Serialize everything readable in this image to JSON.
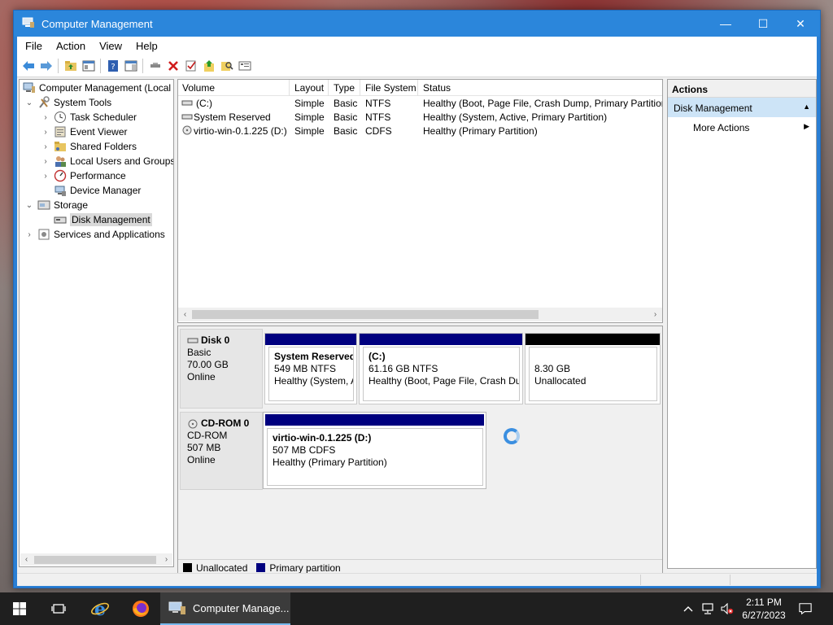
{
  "window": {
    "title": "Computer Management",
    "minimize_glyph": "—",
    "maximize_glyph": "☐",
    "close_glyph": "✕"
  },
  "menu": [
    "File",
    "Action",
    "View",
    "Help"
  ],
  "toolbar_icons": [
    "back-icon",
    "forward-icon",
    "up-folder-icon",
    "show-hide-tree-icon",
    "help-icon",
    "properties-view-icon",
    "connect-icon",
    "delete-icon",
    "check-icon",
    "import-icon",
    "search-icon",
    "disk-list-icon"
  ],
  "tree": {
    "root": "Computer Management (Local",
    "system_tools": "System Tools",
    "task_scheduler": "Task Scheduler",
    "event_viewer": "Event Viewer",
    "shared_folders": "Shared Folders",
    "local_users": "Local Users and Groups",
    "performance": "Performance",
    "device_manager": "Device Manager",
    "storage": "Storage",
    "disk_management": "Disk Management",
    "services": "Services and Applications"
  },
  "volumes": {
    "headers": {
      "volume": "Volume",
      "layout": "Layout",
      "type": "Type",
      "fs": "File System",
      "status": "Status"
    },
    "rows": [
      {
        "volume": "(C:)",
        "layout": "Simple",
        "type": "Basic",
        "fs": "NTFS",
        "status": "Healthy (Boot, Page File, Crash Dump, Primary Partition"
      },
      {
        "volume": "System Reserved",
        "layout": "Simple",
        "type": "Basic",
        "fs": "NTFS",
        "status": "Healthy (System, Active, Primary Partition)"
      },
      {
        "volume": "virtio-win-0.1.225 (D:)",
        "layout": "Simple",
        "type": "Basic",
        "fs": "CDFS",
        "status": "Healthy (Primary Partition)"
      }
    ]
  },
  "disks": {
    "disk0": {
      "name": "Disk 0",
      "type": "Basic",
      "size": "70.00 GB",
      "state": "Online",
      "parts": [
        {
          "name": "System Reserved",
          "size": "549 MB NTFS",
          "status": "Healthy (System, A"
        },
        {
          "name": "(C:)",
          "size": "61.16 GB NTFS",
          "status": "Healthy (Boot, Page File, Crash Dum"
        },
        {
          "name": "",
          "size": "8.30 GB",
          "status": "Unallocated"
        }
      ]
    },
    "cdrom0": {
      "name": "CD-ROM 0",
      "type": "CD-ROM",
      "size": "507 MB",
      "state": "Online",
      "part": {
        "name": "virtio-win-0.1.225  (D:)",
        "size": "507 MB CDFS",
        "status": "Healthy (Primary Partition)"
      }
    }
  },
  "legend": {
    "unallocated": "Unallocated",
    "primary": "Primary partition"
  },
  "colors": {
    "primary_bar": "#00007f",
    "unallocated_bar": "#000000",
    "titlebar": "#2b86db",
    "selection": "#cde4f7"
  },
  "actions": {
    "title": "Actions",
    "section": "Disk Management",
    "more": "More Actions"
  },
  "taskbar": {
    "app_label": "Computer Manage...",
    "time": "2:11 PM",
    "date": "6/27/2023"
  }
}
